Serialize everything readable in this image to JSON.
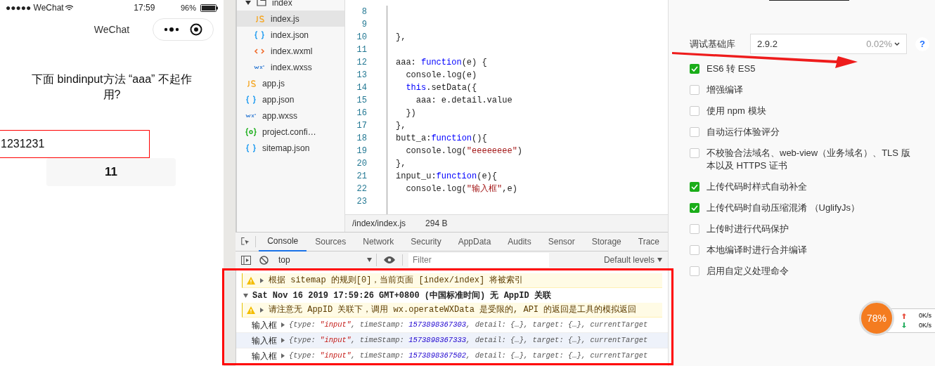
{
  "phone": {
    "status_bar": {
      "carrier": "●●●●● WeChat",
      "time": "17:59",
      "battery": "96%"
    },
    "nav_title": "WeChat",
    "question": "下面 bindinput方法 “aaa” 不起作用?",
    "input_value": "1231231",
    "button": "11"
  },
  "file_tree": [
    {
      "name": "index",
      "kind": "folder",
      "expanded": true,
      "selected": false,
      "children": [
        {
          "name": "index.js",
          "kind": "js",
          "selected": true
        },
        {
          "name": "index.json",
          "kind": "json",
          "selected": false
        },
        {
          "name": "index.wxml",
          "kind": "wxml",
          "selected": false
        },
        {
          "name": "index.wxss",
          "kind": "wxss",
          "selected": false
        }
      ]
    },
    {
      "name": "app.js",
      "kind": "js",
      "selected": false
    },
    {
      "name": "app.json",
      "kind": "json",
      "selected": false
    },
    {
      "name": "app.wxss",
      "kind": "wxss",
      "selected": false
    },
    {
      "name": "project.confi…",
      "kind": "config",
      "selected": false
    },
    {
      "name": "sitemap.json",
      "kind": "json",
      "selected": false
    }
  ],
  "editor": {
    "lines": [
      {
        "number": "8"
      },
      {
        "number": "9"
      },
      {
        "number": "10",
        "tokens": [
          {
            "text": "},",
            "kind": "plain"
          }
        ]
      },
      {
        "number": "11"
      },
      {
        "number": "12",
        "tokens": [
          {
            "text": "aaa: ",
            "kind": "plain"
          },
          {
            "text": "function",
            "kind": "keyword"
          },
          {
            "text": "(e) {",
            "kind": "plain"
          }
        ]
      },
      {
        "number": "13",
        "tokens": [
          {
            "text": "  console.log(e)",
            "kind": "plain"
          }
        ]
      },
      {
        "number": "14",
        "tokens": [
          {
            "text": "  this",
            "kind": "keyword"
          },
          {
            "text": ".setData({",
            "kind": "plain"
          }
        ]
      },
      {
        "number": "15",
        "tokens": [
          {
            "text": "    aaa: e.detail.value",
            "kind": "plain"
          }
        ]
      },
      {
        "number": "16",
        "tokens": [
          {
            "text": "  })",
            "kind": "plain"
          }
        ]
      },
      {
        "number": "17",
        "tokens": [
          {
            "text": "},",
            "kind": "plain"
          }
        ]
      },
      {
        "number": "18",
        "tokens": [
          {
            "text": "butt_a:",
            "kind": "plain"
          },
          {
            "text": "function",
            "kind": "keyword"
          },
          {
            "text": "(){",
            "kind": "plain"
          }
        ]
      },
      {
        "number": "19",
        "tokens": [
          {
            "text": "  console.log(",
            "kind": "plain"
          },
          {
            "text": "\"eeeeeeee\"",
            "kind": "string"
          },
          {
            "text": ")",
            "kind": "plain"
          }
        ]
      },
      {
        "number": "20",
        "tokens": [
          {
            "text": "},",
            "kind": "plain"
          }
        ]
      },
      {
        "number": "21",
        "tokens": [
          {
            "text": "input_u:",
            "kind": "plain"
          },
          {
            "text": "function",
            "kind": "keyword"
          },
          {
            "text": "(e){",
            "kind": "plain"
          }
        ]
      },
      {
        "number": "22",
        "tokens": [
          {
            "text": "  console.log(",
            "kind": "plain"
          },
          {
            "text": "\"输入框\"",
            "kind": "string"
          },
          {
            "text": ",e)",
            "kind": "plain"
          }
        ]
      },
      {
        "number": "23"
      }
    ],
    "file_path": "/index/index.js",
    "file_size": "294 B"
  },
  "devtools": {
    "tabs": [
      {
        "label": "Console",
        "selected": true
      },
      {
        "label": "Sources",
        "selected": false
      },
      {
        "label": "Network",
        "selected": false
      },
      {
        "label": "Security",
        "selected": false
      },
      {
        "label": "AppData",
        "selected": false
      },
      {
        "label": "Audits",
        "selected": false
      },
      {
        "label": "Sensor",
        "selected": false
      },
      {
        "label": "Storage",
        "selected": false
      },
      {
        "label": "Trace",
        "selected": false
      }
    ],
    "context": "top",
    "filter_placeholder": "Filter",
    "levels": "Default levels",
    "messages": [
      {
        "kind": "warning",
        "text": "根据 sitemap 的规则[0]，当前页面 [index/index] 将被索引"
      },
      {
        "kind": "group",
        "text": "Sat Nov 16 2019 17:59:26 GMT+0800 (中国标准时间) 无 AppID 关联"
      },
      {
        "kind": "warning",
        "text": "请注意无 AppID 关联下，调用 wx.operateWXData 是受限的, API 的返回是工具的模拟返回"
      },
      {
        "kind": "log",
        "label": "输入框",
        "tokens": [
          {
            "text": "{type: ",
            "kind": "key"
          },
          {
            "text": "\"input\"",
            "kind": "string"
          },
          {
            "text": ", timeStamp: ",
            "kind": "key"
          },
          {
            "text": "1573898367303",
            "kind": "number"
          },
          {
            "text": ", detail: {…}, target: {…}, currentTarget",
            "kind": "key"
          }
        ]
      },
      {
        "kind": "log",
        "label": "输入框",
        "tokens": [
          {
            "text": "{type: ",
            "kind": "key"
          },
          {
            "text": "\"input\"",
            "kind": "string"
          },
          {
            "text": ", timeStamp: ",
            "kind": "key"
          },
          {
            "text": "1573898367333",
            "kind": "number"
          },
          {
            "text": ", detail: {…}, target: {…}, currentTarget",
            "kind": "key"
          }
        ]
      },
      {
        "kind": "log",
        "label": "输入框",
        "tokens": [
          {
            "text": "{type: ",
            "kind": "key"
          },
          {
            "text": "\"input\"",
            "kind": "string"
          },
          {
            "text": ", timeStamp: ",
            "kind": "key"
          },
          {
            "text": "1573898367502",
            "kind": "number"
          },
          {
            "text": ", detail: {…}, target: {…}, currentTarget",
            "kind": "key"
          }
        ]
      }
    ]
  },
  "settings": {
    "library_label": "调试基础库",
    "library_version": "2.9.2",
    "library_share": "0.02%",
    "help": "?",
    "options": [
      {
        "label": "ES6 转 ES5",
        "checked": true
      },
      {
        "label": "增强编译",
        "checked": false
      },
      {
        "label": "使用 npm 模块",
        "checked": false
      },
      {
        "label": "自动运行体验评分",
        "checked": false
      },
      {
        "label": "不校验合法域名、web-view（业务域名）、TLS 版本以及 HTTPS 证书",
        "checked": false
      },
      {
        "label": "上传代码时样式自动补全",
        "checked": true
      },
      {
        "label": "上传代码时自动压缩混淆 （UglifyJs）",
        "checked": true
      },
      {
        "label": "上传时进行代码保护",
        "checked": false
      },
      {
        "label": "本地编译时进行合并编译",
        "checked": false
      },
      {
        "label": "启用自定义处理命令",
        "checked": false
      }
    ]
  },
  "speed_widget": {
    "percent": "78%",
    "upload": "0K/s",
    "download": "0K/s"
  }
}
